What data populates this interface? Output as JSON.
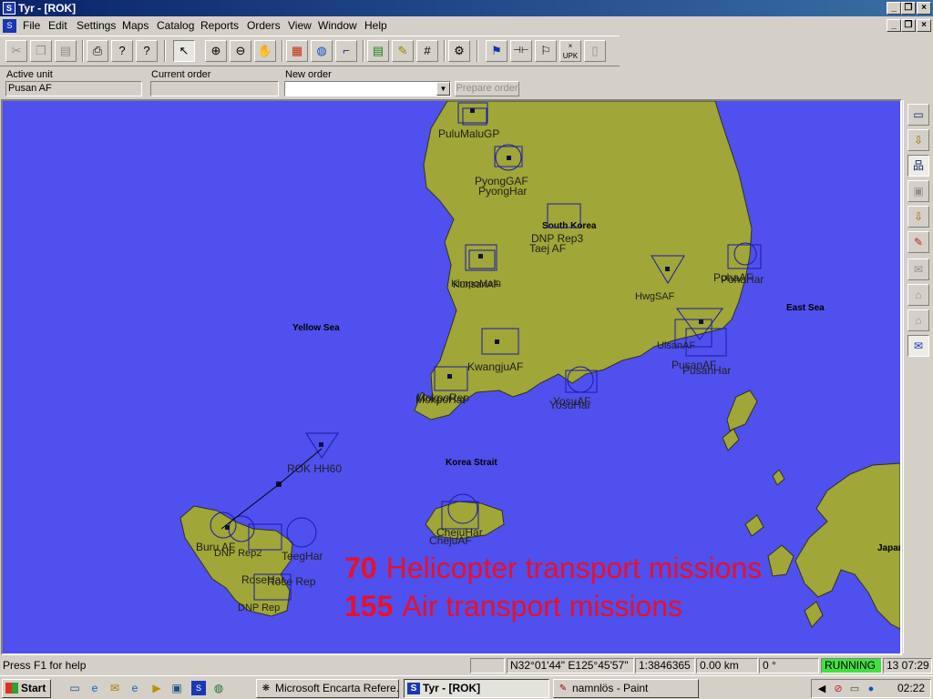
{
  "window": {
    "title": "Tyr - [ROK]",
    "app_icon": "tyr-app-icon",
    "controls": [
      "minimize-icon",
      "restore-icon",
      "close-icon"
    ]
  },
  "menu": {
    "items": [
      "File",
      "Edit",
      "Settings",
      "Maps",
      "Catalog",
      "Reports",
      "Orders",
      "View",
      "Window",
      "Help"
    ]
  },
  "toolbar": {
    "tools": [
      {
        "name": "cut",
        "icon": "scissors-icon",
        "glyph": "✂",
        "enabled": false
      },
      {
        "name": "copy",
        "icon": "copy-icon",
        "glyph": "❐",
        "enabled": false
      },
      {
        "name": "paste",
        "icon": "paste-icon",
        "glyph": "📋",
        "enabled": false
      },
      {
        "name": "print",
        "icon": "printer-icon",
        "glyph": "🖶",
        "enabled": true
      },
      {
        "name": "about",
        "icon": "help-icon",
        "glyph": "?",
        "enabled": true
      },
      {
        "name": "context-help",
        "icon": "context-help-icon",
        "glyph": "?",
        "enabled": true
      },
      {
        "name": "select",
        "icon": "pointer-icon",
        "glyph": "↖",
        "enabled": true
      },
      {
        "name": "zoom-in",
        "icon": "zoom-in-icon",
        "glyph": "⊕",
        "enabled": true
      },
      {
        "name": "zoom-out",
        "icon": "zoom-out-icon",
        "glyph": "⊖",
        "enabled": true
      },
      {
        "name": "pan",
        "icon": "hand-icon",
        "glyph": "✋",
        "enabled": true
      },
      {
        "name": "map-layers",
        "icon": "map-icon",
        "glyph": "▦",
        "enabled": true
      },
      {
        "name": "globe",
        "icon": "globe-icon",
        "glyph": "🌐",
        "enabled": true
      },
      {
        "name": "measure",
        "icon": "measure-icon",
        "glyph": "⌐",
        "enabled": true
      },
      {
        "name": "cards",
        "icon": "cards-icon",
        "glyph": "▤",
        "enabled": true
      },
      {
        "name": "edit-card",
        "icon": "edit-card-icon",
        "glyph": "✎",
        "enabled": true
      },
      {
        "name": "grid",
        "icon": "grid-icon",
        "glyph": "#",
        "enabled": true
      },
      {
        "name": "unit-tool",
        "icon": "unit-tool-icon",
        "glyph": "⚙",
        "enabled": true
      },
      {
        "name": "route",
        "icon": "route-icon",
        "glyph": "⚑",
        "enabled": true
      },
      {
        "name": "link",
        "icon": "link-icon",
        "glyph": "⊣⊢",
        "enabled": true
      },
      {
        "name": "flag",
        "icon": "flag-icon",
        "glyph": "⚐",
        "enabled": true
      },
      {
        "name": "upk",
        "icon": "upk-icon",
        "glyph": "UPK",
        "enabled": true
      },
      {
        "name": "delete",
        "icon": "trash-icon",
        "glyph": "🗑",
        "enabled": false
      }
    ]
  },
  "orderbar": {
    "active_unit_label": "Active unit",
    "active_unit_value": "Pusan AF",
    "current_order_label": "Current order",
    "current_order_value": "",
    "new_order_label": "New order",
    "new_order_value": "",
    "prepare_button": "Prepare order"
  },
  "map": {
    "sea_color": "#5050ee",
    "land_color": "#a0a638",
    "symbol_color": "#1a1aa8",
    "region_labels": [
      "South Korea",
      "Yellow Sea",
      "East Sea",
      "Korea Strait",
      "Japan"
    ],
    "unit_labels": [
      "PuluMaluGP",
      "PyongGAF",
      "PyongHar",
      "DNP Rep3",
      "Taej AF",
      "KunsanAF",
      "HwgSAF",
      "PohaAF",
      "PohaHar",
      "KimpoMalu",
      "KwangjuAF",
      "MokpoHar",
      "MokpoRep",
      "YosuHar",
      "YosuAF",
      "UlsanAF",
      "PusanAF",
      "PusanHar",
      "ROK HH60",
      "ChejuAF",
      "ChejuHar",
      "Buru AF",
      "DNP Rep",
      "RoseHar",
      "TeegHar",
      "DNP Rep2",
      "Rose Rep"
    ],
    "mission_stats": [
      {
        "count": "70",
        "label": "Helicopter transport missions"
      },
      {
        "count": "155",
        "label": "Air transport missions"
      }
    ],
    "mission_text_color": "#e8102a"
  },
  "sidebar_tools": [
    {
      "icon": "card-icon",
      "glyph": "▭",
      "enabled": true
    },
    {
      "icon": "download-order-icon",
      "glyph": "⇩",
      "enabled": true
    },
    {
      "icon": "network-icon",
      "glyph": "品",
      "enabled": true
    },
    {
      "icon": "computer-icon",
      "glyph": "▣",
      "enabled": false
    },
    {
      "icon": "download-card-icon",
      "glyph": "⇩",
      "enabled": true
    },
    {
      "icon": "pencil-icon",
      "glyph": "✎",
      "enabled": true
    },
    {
      "icon": "mail-query-icon",
      "glyph": "✉",
      "enabled": false
    },
    {
      "icon": "building-icon",
      "glyph": "⌂",
      "enabled": false
    },
    {
      "icon": "home-query-icon",
      "glyph": "⌂",
      "enabled": false
    },
    {
      "icon": "mail-active-icon",
      "glyph": "✉",
      "enabled": true
    }
  ],
  "statusbar": {
    "help": "Press F1 for help",
    "coords": "N32°01'44\" E125°45'57\"",
    "scale": "1:3846365",
    "distance": "0.00 km",
    "bearing": "0 °",
    "state": "RUNNING",
    "state_color": "#40e040",
    "time": "13 07:29"
  },
  "taskbar": {
    "start": "Start",
    "tasks": [
      {
        "label": "Microsoft Encarta Refere...",
        "icon": "encarta-icon",
        "active": false
      },
      {
        "label": "Tyr - [ROK]",
        "icon": "tyr-task-icon",
        "active": true
      },
      {
        "label": "namnlös - Paint",
        "icon": "paint-icon",
        "active": false
      }
    ],
    "clock": "02:22"
  }
}
